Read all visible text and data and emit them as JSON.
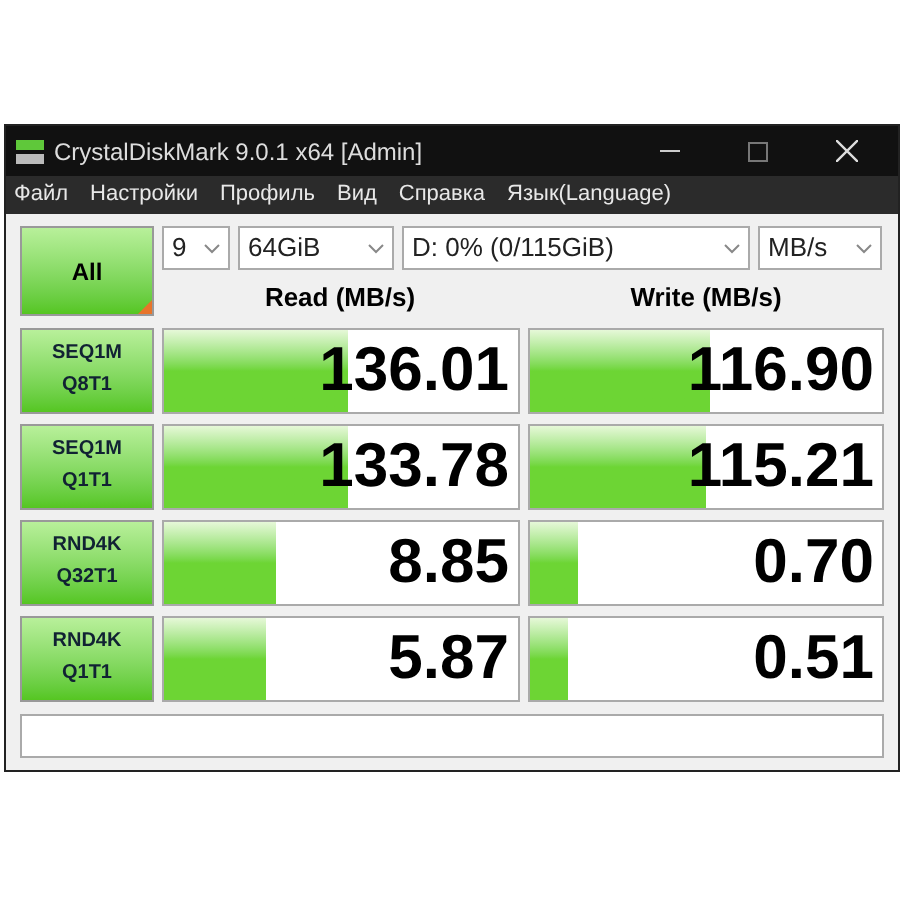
{
  "window": {
    "title": "CrystalDiskMark 9.0.1 x64 [Admin]"
  },
  "menu": [
    "Файл",
    "Настройки",
    "Профиль",
    "Вид",
    "Справка",
    "Язык(Language)"
  ],
  "all_button": {
    "label": "All"
  },
  "selectors": [
    {
      "value": "9"
    },
    {
      "value": "64GiB"
    },
    {
      "value": "D: 0% (0/115GiB)"
    },
    {
      "value": "MB/s"
    }
  ],
  "columns": [
    "Read (MB/s)",
    "Write (MB/s)"
  ],
  "rows": [
    {
      "test_line1": "SEQ1M",
      "test_line2": "Q8T1",
      "read": {
        "value": "136.01",
        "level": 0.52
      },
      "write": {
        "value": "116.90",
        "level": 0.51
      }
    },
    {
      "test_line1": "SEQ1M",
      "test_line2": "Q1T1",
      "read": {
        "value": "133.78",
        "level": 0.52
      },
      "write": {
        "value": "115.21",
        "level": 0.5
      }
    },
    {
      "test_line1": "RND4K",
      "test_line2": "Q32T1",
      "read": {
        "value": "8.85",
        "level": 0.32
      },
      "write": {
        "value": "0.70",
        "level": 0.14
      }
    },
    {
      "test_line1": "RND4K",
      "test_line2": "Q1T1",
      "read": {
        "value": "5.87",
        "level": 0.29
      },
      "write": {
        "value": "0.51",
        "level": 0.11
      }
    }
  ]
}
